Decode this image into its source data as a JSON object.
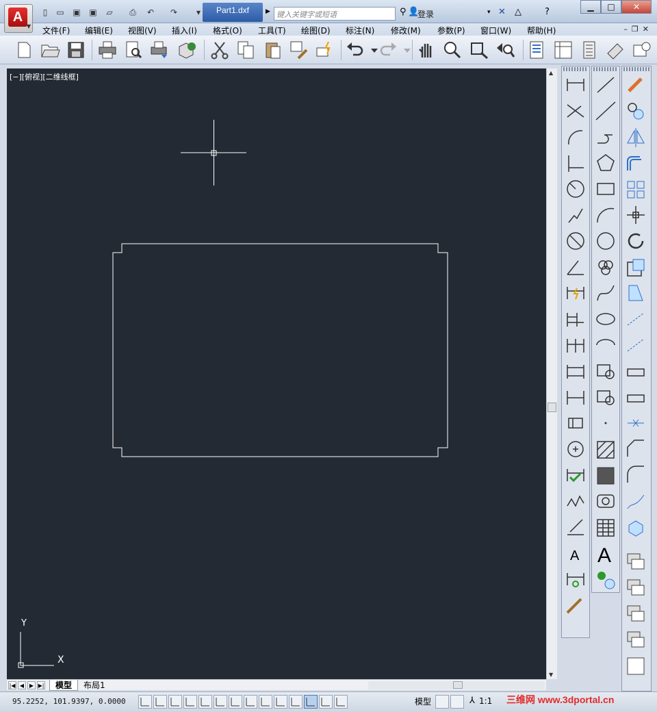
{
  "app": {
    "doc_tab": "Part1.dxf",
    "search_placeholder": "键入关键字或短语",
    "login": "登录"
  },
  "menu": [
    "文件(F)",
    "编辑(E)",
    "视图(V)",
    "插入(I)",
    "格式(O)",
    "工具(T)",
    "绘图(D)",
    "标注(N)",
    "修改(M)",
    "参数(P)",
    "窗口(W)",
    "帮助(H)"
  ],
  "viewport": {
    "label": "[−][俯视][二维线框]"
  },
  "ucs": {
    "x_label": "X",
    "y_label": "Y"
  },
  "tabs": {
    "model": "模型",
    "layout1": "布局1"
  },
  "status": {
    "coordinates": "95.2252,  101.9397, 0.0000",
    "model": "模型",
    "scale": "1:1"
  },
  "watermark": "三维网 www.3dportal.cn",
  "colors": {
    "canvas": "#232a33",
    "geometry": "#ffffff",
    "accent": "#2c5ba6"
  }
}
